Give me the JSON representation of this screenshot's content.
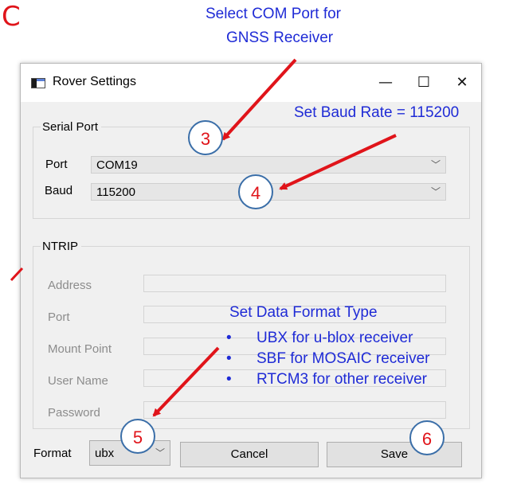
{
  "annotations": {
    "select_com_line1": "Select COM Port for",
    "select_com_line2": "GNSS Receiver",
    "set_baud": "Set Baud Rate = 115200",
    "set_format_title": "Set Data Format Type",
    "format_bullets": [
      "UBX for u-blox receiver",
      "SBF for MOSAIC receiver",
      "RTCM3 for other receiver"
    ],
    "bullet_char": "•",
    "step_numbers": [
      "3",
      "4",
      "5",
      "6"
    ],
    "cut_letter": "C",
    "colors": {
      "annotation_text": "#1f2bd6",
      "arrow": "#e0141a",
      "circle_border": "#3a6ea8"
    }
  },
  "dialog": {
    "title": "Rover Settings",
    "controls": {
      "minimize": "—",
      "maximize": "☐",
      "close": "✕"
    },
    "serial_port": {
      "group_label": "Serial Port",
      "port_label": "Port",
      "port_value": "COM19",
      "baud_label": "Baud",
      "baud_value": "115200"
    },
    "ntrip": {
      "group_label": "NTRIP",
      "fields": [
        "Address",
        "Port",
        "Mount Point",
        "User Name",
        "Password"
      ]
    },
    "format_label": "Format",
    "format_value": "ubx",
    "cancel_label": "Cancel",
    "save_label": "Save"
  }
}
